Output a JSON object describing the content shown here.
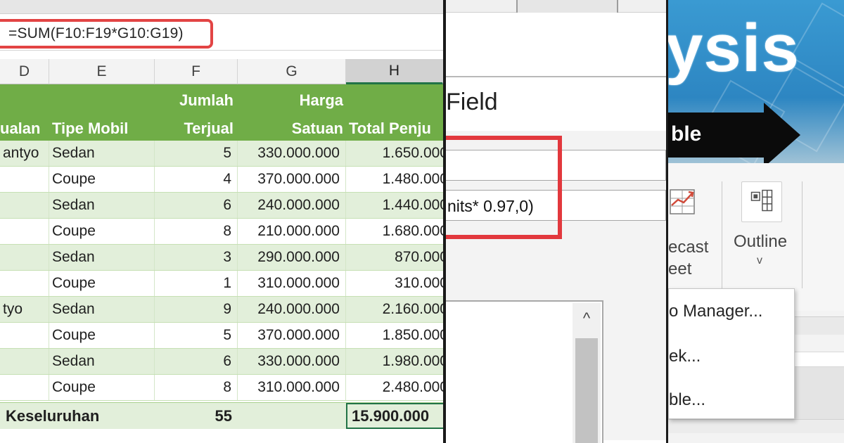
{
  "spreadsheet": {
    "formula": "=SUM(F10:F19*G10:G19)",
    "column_headers": [
      "D",
      "E",
      "F",
      "G",
      "H"
    ],
    "header_row": {
      "col_d": "ualan",
      "col_e": "Tipe Mobil",
      "col_f_line1": "Jumlah",
      "col_f_line2": "Terjual",
      "col_g_line1": "Harga",
      "col_g_line2": "Satuan",
      "col_h": "Total Penju"
    },
    "rows": [
      {
        "d": "antyo",
        "e": "Sedan",
        "f": "5",
        "g": "330.000.000",
        "h": "1.650.000"
      },
      {
        "d": "",
        "e": "Coupe",
        "f": "4",
        "g": "370.000.000",
        "h": "1.480.000"
      },
      {
        "d": "",
        "e": "Sedan",
        "f": "6",
        "g": "240.000.000",
        "h": "1.440.000"
      },
      {
        "d": "",
        "e": "Coupe",
        "f": "8",
        "g": "210.000.000",
        "h": "1.680.000"
      },
      {
        "d": "",
        "e": "Sedan",
        "f": "3",
        "g": "290.000.000",
        "h": "870.000"
      },
      {
        "d": "",
        "e": "Coupe",
        "f": "1",
        "g": "310.000.000",
        "h": "310.000"
      },
      {
        "d": "tyo",
        "e": "Sedan",
        "f": "9",
        "g": "240.000.000",
        "h": "2.160.000"
      },
      {
        "d": "",
        "e": "Coupe",
        "f": "5",
        "g": "370.000.000",
        "h": "1.850.000"
      },
      {
        "d": "",
        "e": "Sedan",
        "f": "6",
        "g": "330.000.000",
        "h": "1.980.000"
      },
      {
        "d": "",
        "e": "Coupe",
        "f": "8",
        "g": "310.000.000",
        "h": "2.480.000"
      }
    ],
    "total_row": {
      "label": "Keseluruhan",
      "f": "55",
      "h": "15.900.000"
    },
    "colors": {
      "header_green": "#70ad47",
      "band_light": "#e2efda",
      "highlight_red": "#e24444"
    }
  },
  "dialog": {
    "title": "Field",
    "formula_fragment": "nits* 0.97,0)",
    "scroll_up_glyph": "^"
  },
  "ribbon": {
    "banner_word": "ysis",
    "arrow_text": "ble",
    "forecast_line1": "ecast",
    "forecast_line2": "eet",
    "outline_label": "Outline",
    "outline_chevron": "v",
    "menu_items": [
      "o Manager...",
      "ek...",
      "ble..."
    ]
  }
}
